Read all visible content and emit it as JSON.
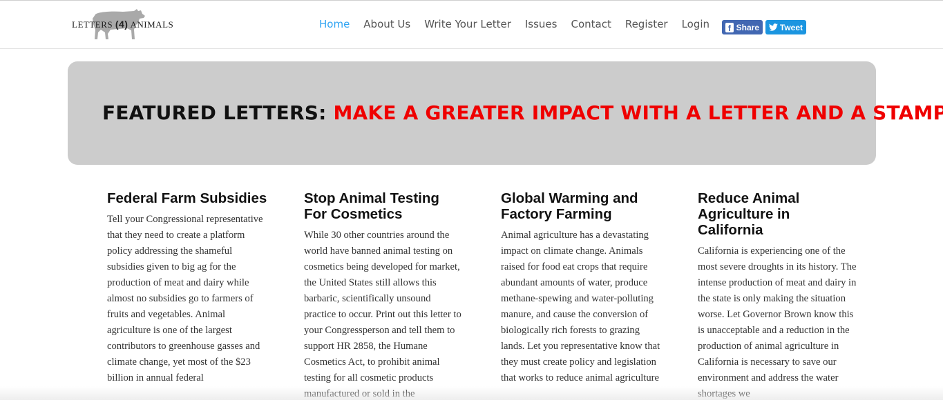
{
  "logo": {
    "text_left": "LETTERS ",
    "text_mid": "(4)",
    "text_right": " ANIMALS"
  },
  "nav": {
    "items": [
      {
        "label": "Home"
      },
      {
        "label": "About Us"
      },
      {
        "label": "Write Your Letter"
      },
      {
        "label": "Issues"
      },
      {
        "label": "Contact"
      },
      {
        "label": "Register"
      },
      {
        "label": "Login"
      }
    ],
    "active_color": "#2ea3f2"
  },
  "social": {
    "share_label": "Share",
    "tweet_label": "Tweet",
    "share_color": "#4267b2",
    "tweet_color": "#1b95e0"
  },
  "banner": {
    "prefix": "FEATURED LETTERS: ",
    "highlight": "MAKE A GREATER IMPACT WITH A LETTER AND A STAMP",
    "highlight_color": "#ef0000"
  },
  "columns": [
    {
      "title": "Federal Farm Subsidies",
      "body": "Tell your Congressional representative that they need to create a platform policy addressing the shameful subsidies given to big ag for the production of meat and dairy while almost no subsidies go to farmers of fruits and vegetables. Animal agriculture is one of the largest contributors to greenhouse gasses and climate change, yet most of the $23 billion in annual federal"
    },
    {
      "title": "Stop Animal Testing For Cosmetics",
      "body": "While 30 other countries around the world have banned animal testing on cosmetics being developed for market, the United States still allows this barbaric, scientifically unsound practice to occur. Print out this letter to your Congressperson and tell them to support HR 2858, the Humane Cosmetics Act, to prohibit animal testing for all cosmetic products manufactured or sold in the"
    },
    {
      "title": "Global Warming and Factory Farming",
      "body": "Animal agriculture has a devastating impact on climate change. Animals raised for food eat crops that require abundant amounts of water, produce methane-spewing and water-polluting manure, and cause the conversion of biologically rich forests to grazing lands. Let you representative know that they must create policy and legislation that works to reduce animal agriculture"
    },
    {
      "title": "Reduce Animal Agriculture in California",
      "body": "California is experiencing one of the most severe droughts in its history. The intense production of meat and dairy in the state is only making the situation worse. Let Governor Brown know this is unacceptable and a reduction in the production of animal agriculture in California is necessary to save our environment and address the water shortages we"
    }
  ]
}
